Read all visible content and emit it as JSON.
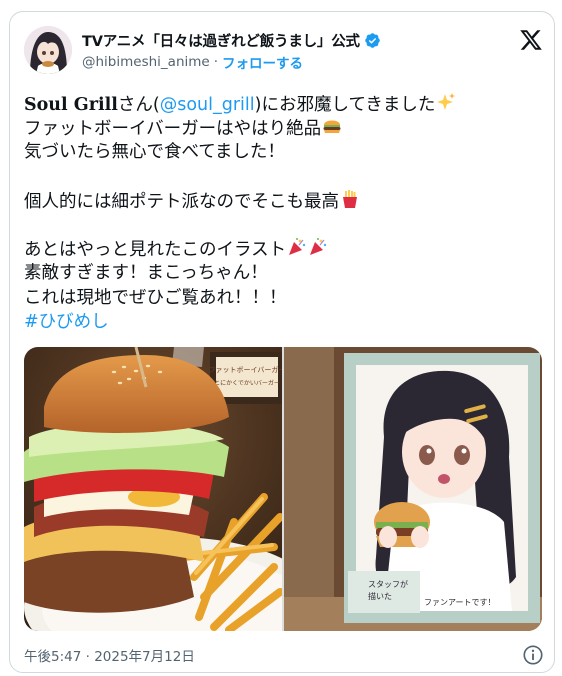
{
  "tweet": {
    "display_name": "TVアニメ「日々は過ぎれど飯うまし」公式",
    "handle": "@hibimeshi_anime",
    "separator": "·",
    "follow_label": "フォローする",
    "body": {
      "line1_brand": "Soul Grill",
      "line1_pre": "さん(",
      "line1_mention": "@soul_grill",
      "line1_post": ")にお邪魔してきました",
      "line2": "ファットボーイバーガーはやはり絶品",
      "line3": "気づいたら無心で食べてました！",
      "line4": "個人的には細ポテト派なのでそこも最高",
      "line5": "あとはやっと見れたこのイラスト",
      "line6": "素敵すぎます！まこっちゃん！",
      "line7": "これは現地でぜひご覧あれ！！！",
      "hashtag": "#ひびめし"
    },
    "photo_left": {
      "menu_text": "ファットボーイバーガー",
      "menu_sub": "とにかくでかいバーガー"
    },
    "photo_right": {
      "card_text_1": "スタッフが",
      "card_text_2": "描いた",
      "card_text_3": "ファンアートです！"
    },
    "timestamp": "午後5:47 · 2025年7月12日"
  },
  "colors": {
    "link": "#1d9bf0",
    "secondary_text": "#536471",
    "border": "#cfd9de"
  },
  "icons": [
    "verified-badge-icon",
    "x-logo-icon",
    "sparkles-emoji-icon",
    "hamburger-emoji-icon",
    "fries-emoji-icon",
    "party-popper-emoji-icon",
    "info-icon"
  ]
}
